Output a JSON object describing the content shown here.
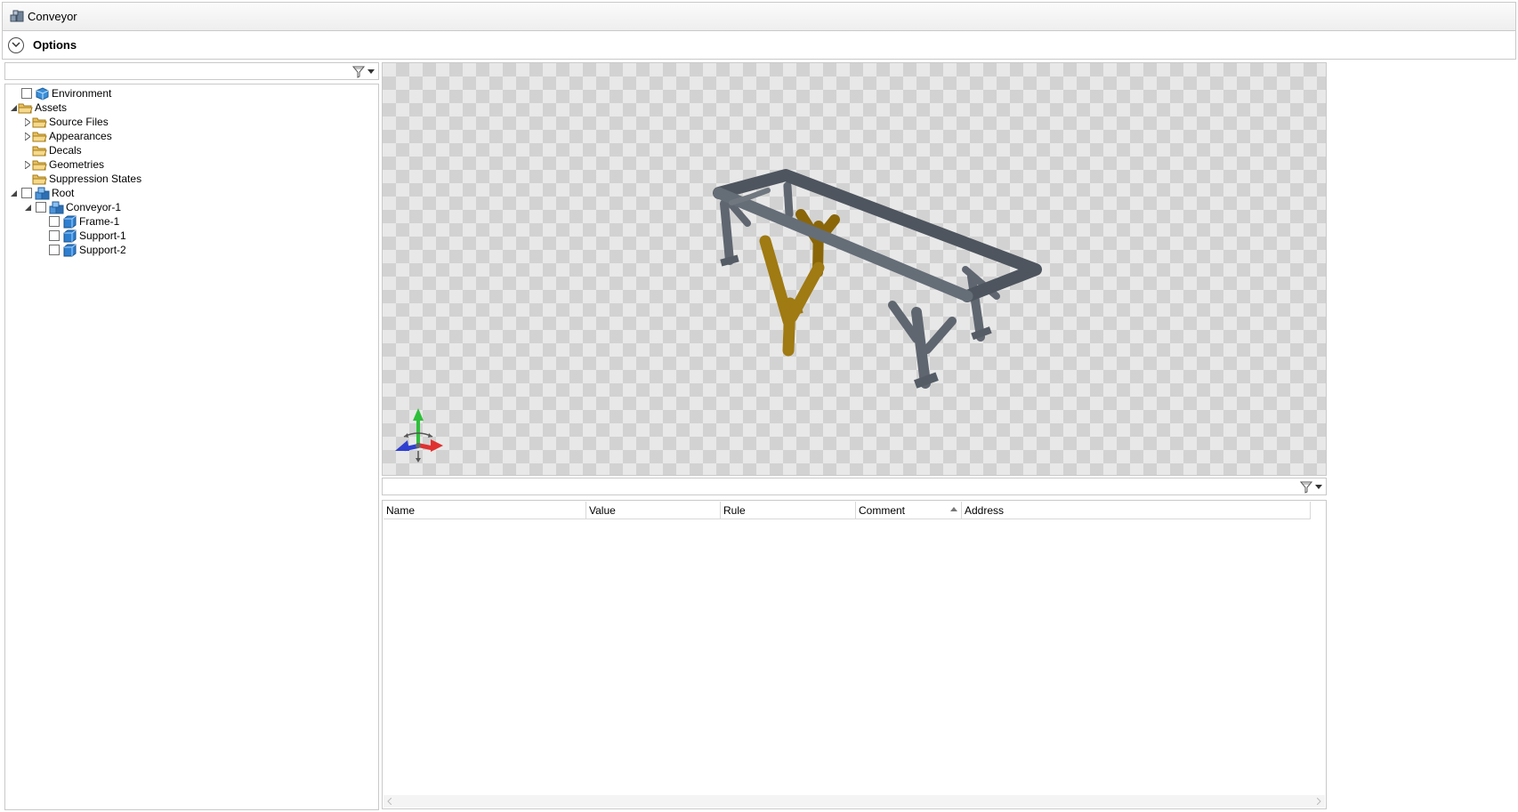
{
  "window": {
    "title": "Conveyor"
  },
  "options": {
    "label": "Options"
  },
  "tree_filter": {
    "value": ""
  },
  "tree": [
    {
      "label": "Environment",
      "checkbox": true,
      "icon": "environment-icon",
      "expander": "none"
    },
    {
      "label": "Assets",
      "checkbox": false,
      "icon": "folder-icon",
      "expander": "expanded"
    },
    {
      "label": "Source Files",
      "checkbox": false,
      "icon": "folder-icon",
      "expander": "collapsed"
    },
    {
      "label": "Appearances",
      "checkbox": false,
      "icon": "folder-icon",
      "expander": "collapsed"
    },
    {
      "label": "Decals",
      "checkbox": false,
      "icon": "folder-icon",
      "expander": "none"
    },
    {
      "label": "Geometries",
      "checkbox": false,
      "icon": "folder-icon",
      "expander": "collapsed"
    },
    {
      "label": "Suppression States",
      "checkbox": false,
      "icon": "folder-icon",
      "expander": "none"
    },
    {
      "label": "Root",
      "checkbox": true,
      "icon": "assembly-icon",
      "expander": "expanded"
    },
    {
      "label": "Conveyor-1",
      "checkbox": true,
      "icon": "assembly-icon",
      "expander": "expanded"
    },
    {
      "label": "Frame-1",
      "checkbox": true,
      "icon": "part-icon",
      "expander": "none"
    },
    {
      "label": "Support-1",
      "checkbox": true,
      "icon": "part-icon",
      "expander": "none"
    },
    {
      "label": "Support-2",
      "checkbox": true,
      "icon": "part-icon",
      "expander": "none"
    }
  ],
  "viewport": {
    "model": "conveyor-3d-model",
    "triad": "axis-triad-icon"
  },
  "property_filter": {
    "value": ""
  },
  "grid": {
    "columns": [
      "Name",
      "Value",
      "Rule",
      "Comment",
      "Address"
    ],
    "sorted_column": "Comment",
    "rows": []
  },
  "colors": {
    "frame": "#5f6670",
    "support": "#a07a12",
    "border": "#c9c9c9"
  }
}
